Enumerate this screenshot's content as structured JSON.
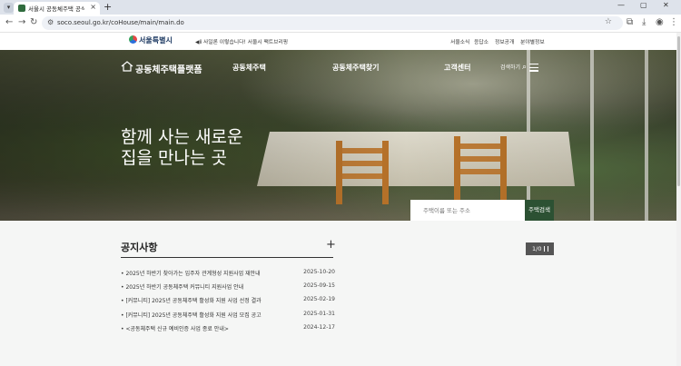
{
  "browser": {
    "tab_title": "서울시 공동체주택 공식플랫폼",
    "url": "soco.seoul.go.kr/coHouse/main/main.do",
    "icons": [
      "tab-search-icon",
      "back-icon",
      "forward-icon",
      "reload-icon",
      "site-info-icon",
      "star-icon",
      "extensions-icon",
      "download-icon",
      "profile-icon",
      "menu-dots-icon"
    ]
  },
  "site_header": {
    "logo": "서울특별시",
    "notice": "◀ⅱ 사일론 이렇습니다! 서울시 팩트브리핑",
    "utilities": [
      "서울소식",
      "응답소",
      "정보공개",
      "분야별정보"
    ]
  },
  "nav": {
    "brand": "공동체주택플랫폼",
    "menu": [
      "공동체주택",
      "공동체주택찾기",
      "고객센터"
    ],
    "search_label": "검색하기"
  },
  "hero": {
    "title_line1": "함께 사는 새로운",
    "title_line2": "집을 만나는 곳",
    "search_placeholder": "주택이름 또는 주소",
    "search_button": "주택검색"
  },
  "notices": {
    "title": "공지사항",
    "items": [
      {
        "title": "• 2025년 하반기 찾아가는 입주자 관계형성 지원사업 재안내",
        "date": "2025-10-20"
      },
      {
        "title": "• 2025년 하반기 공동체주택 커뮤니티 지원사업 안내",
        "date": "2025-09-15"
      },
      {
        "title": "• [커뮤니티] 2025년 공동체주택 활성화 지원 사업 선정 결과",
        "date": "2025-02-19"
      },
      {
        "title": "• [커뮤니티] 2025년 공동체주택 활성화 지원 사업 모집 공고",
        "date": "2025-01-31"
      },
      {
        "title": "• <공동체주택 신규 예비인증 사업 종료 안내>",
        "date": "2024-12-17"
      }
    ]
  },
  "slider": {
    "pager": "1/0"
  },
  "colors": {
    "accent": "#2c5133",
    "pager": "#555555"
  }
}
